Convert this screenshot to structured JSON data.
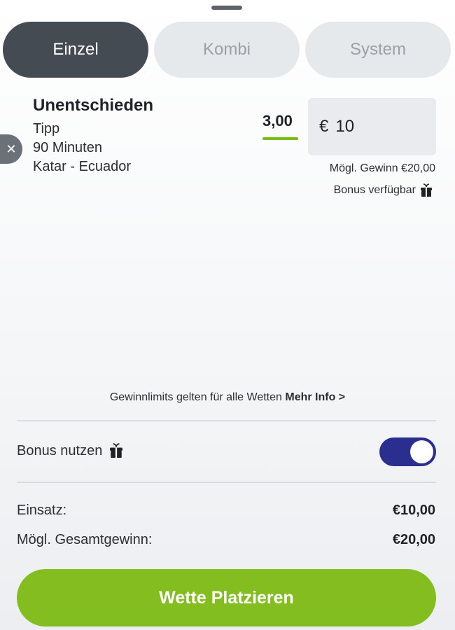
{
  "tabs": [
    {
      "label": "Einzel",
      "active": true
    },
    {
      "label": "Kombi",
      "active": false
    },
    {
      "label": "System",
      "active": false
    }
  ],
  "bet": {
    "remove_icon": "close-icon",
    "selection": "Unentschieden",
    "market": "Tipp",
    "period": "90 Minuten",
    "event": "Katar - Ecuador",
    "odds": "3,00",
    "stake_currency": "€",
    "stake_value": "10",
    "possible_win": "Mögl. Gewinn €20,00",
    "bonus_available": "Bonus verfügbar",
    "bonus_icon": "gift-icon"
  },
  "limits": {
    "text": "Gewinnlimits gelten für alle Wetten",
    "link": "Mehr Info >"
  },
  "bonus_toggle": {
    "label": "Bonus nutzen",
    "icon": "gift-icon",
    "enabled": true
  },
  "summary": {
    "stake_label": "Einsatz:",
    "stake_value": "€10,00",
    "total_win_label": "Mögl. Gesamtgewinn:",
    "total_win_value": "€20,00"
  },
  "place_button": "Wette Platzieren",
  "colors": {
    "accent_green": "#84bd1f",
    "toggle_blue": "#2a2f8f",
    "active_tab": "#454b53"
  }
}
